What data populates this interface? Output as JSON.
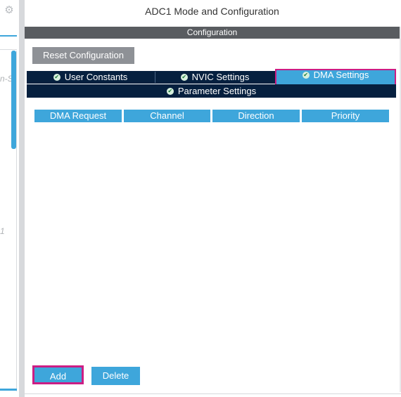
{
  "left_pane": {
    "fragment_text_1": "n-S",
    "fragment_text_2": "1"
  },
  "header": {
    "title": "ADC1 Mode and Configuration",
    "section": "Configuration"
  },
  "toolbar": {
    "reset_label": "Reset Configuration"
  },
  "tabs": [
    {
      "label": "User Constants",
      "icon": "check-circle-icon",
      "active": false
    },
    {
      "label": "NVIC Settings",
      "icon": "check-circle-icon",
      "active": false
    },
    {
      "label": "DMA Settings",
      "icon": "check-circle-icon",
      "active": true
    },
    {
      "label": "Parameter Settings",
      "icon": "check-circle-icon",
      "active": false
    }
  ],
  "dma_table": {
    "columns": [
      "DMA Request",
      "Channel",
      "Direction",
      "Priority"
    ],
    "rows": []
  },
  "actions": {
    "add_label": "Add",
    "delete_label": "Delete"
  },
  "colors": {
    "accent": "#3ea6db",
    "tab_bar": "#06203f",
    "highlight": "#cc1d84",
    "section_bar": "#595c60",
    "reset_button": "#8e9196"
  }
}
